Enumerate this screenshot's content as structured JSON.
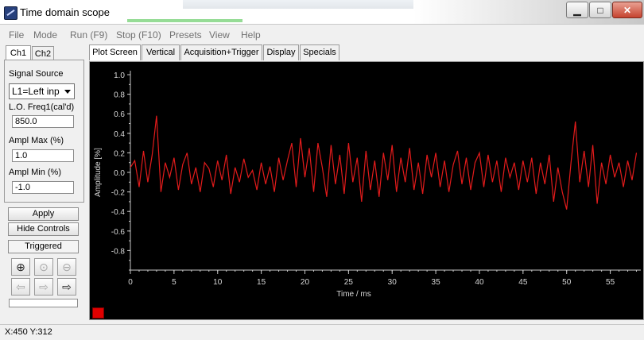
{
  "window": {
    "title": "Time domain scope",
    "minimize_glyph": "▁",
    "maximize_glyph": "□",
    "close_glyph": "✕"
  },
  "menu": [
    "File",
    "Mode",
    "Run (F9)",
    "Stop (F10)",
    "Presets",
    "View",
    "Help"
  ],
  "left_tabs": [
    "Ch1",
    "Ch2"
  ],
  "controls": {
    "signal_source_label": "Signal Source",
    "signal_source_value": "L1=Left inp",
    "lo_freq_label": "L.O. Freq1(cal'd)",
    "lo_freq_value": "850.0",
    "ampl_max_label": "Ampl Max (%)",
    "ampl_max_value": "1.0",
    "ampl_min_label": "Ampl Min (%)",
    "ampl_min_value": "-1.0",
    "apply_label": "Apply",
    "hide_controls_label": "Hide Controls",
    "triggered_label": "Triggered"
  },
  "zoom_icons": [
    "zoom-in-icon",
    "zoom-normal-icon",
    "zoom-out-icon",
    "scroll-left-icon",
    "scroll-right-icon",
    "cursor-icon"
  ],
  "plot_tabs": [
    "Plot Screen",
    "Vertical",
    "Acquisition+Trigger",
    "Display",
    "Specials"
  ],
  "status": "X:450 Y:312",
  "chart_data": {
    "type": "line",
    "xlabel": "Time / ms",
    "ylabel": "Amplitude [%]",
    "xlim": [
      0,
      58.5
    ],
    "ylim": [
      -1.0,
      1.0
    ],
    "x_ticks": [
      0,
      5,
      10,
      15,
      20,
      25,
      30,
      35,
      40,
      45,
      50,
      55
    ],
    "y_ticks": [
      1.0,
      0.8,
      0.6,
      0.4,
      0.2,
      0.0,
      -0.2,
      -0.4,
      -0.6,
      -0.8
    ],
    "y_tick_labels": [
      "1.0",
      "0.8",
      "0.6",
      "0.4",
      "0.2",
      "0.0",
      "-0.2",
      "-0.4",
      "-0.6",
      "-0.8"
    ],
    "grid": false,
    "line_color": "#e21b1b",
    "axis_color": "#c8c8c8",
    "background": "#000000",
    "series": [
      {
        "x": [
          0,
          0.5,
          1,
          1.5,
          2,
          2.5,
          3,
          3.5,
          4,
          4.5,
          5,
          5.5,
          6,
          6.5,
          7,
          7.5,
          8,
          8.5,
          9,
          9.5,
          10,
          10.5,
          11,
          11.5,
          12,
          12.5,
          13,
          13.5,
          14,
          14.5,
          15,
          15.5,
          16,
          16.5,
          17,
          17.5,
          18,
          18.5,
          19,
          19.5,
          20,
          20.5,
          21,
          21.5,
          22,
          22.5,
          23,
          23.5,
          24,
          24.5,
          25,
          25.5,
          26,
          26.5,
          27,
          27.5,
          28,
          28.5,
          29,
          29.5,
          30,
          30.5,
          31,
          31.5,
          32,
          32.5,
          33,
          33.5,
          34,
          34.5,
          35,
          35.5,
          36,
          36.5,
          37,
          37.5,
          38,
          38.5,
          39,
          39.5,
          40,
          40.5,
          41,
          41.5,
          42,
          42.5,
          43,
          43.5,
          44,
          44.5,
          45,
          45.5,
          46,
          46.5,
          47,
          47.5,
          48,
          48.5,
          49,
          49.5,
          50,
          50.5,
          51,
          51.5,
          52,
          52.5,
          53,
          53.5,
          54,
          54.5,
          55,
          55.5,
          56,
          56.5,
          57,
          57.5,
          58
        ],
        "values": [
          0.05,
          0.12,
          -0.15,
          0.22,
          -0.1,
          0.18,
          0.58,
          -0.2,
          0.1,
          -0.05,
          0.15,
          -0.18,
          0.08,
          0.2,
          -0.12,
          0.05,
          -0.2,
          0.1,
          0.04,
          -0.15,
          0.12,
          -0.08,
          0.18,
          -0.22,
          0.05,
          -0.1,
          0.14,
          -0.05,
          0.02,
          -0.18,
          0.1,
          -0.12,
          0.06,
          -0.2,
          0.15,
          -0.08,
          0.12,
          0.3,
          -0.15,
          0.35,
          -0.05,
          0.25,
          -0.2,
          0.3,
          0.05,
          -0.25,
          0.28,
          -0.12,
          0.18,
          -0.22,
          0.3,
          -0.1,
          0.15,
          -0.3,
          0.22,
          -0.18,
          0.12,
          -0.25,
          0.2,
          -0.08,
          0.28,
          -0.2,
          0.15,
          -0.1,
          0.25,
          -0.18,
          0.1,
          -0.22,
          0.18,
          -0.05,
          0.2,
          -0.15,
          0.12,
          -0.2,
          0.08,
          0.22,
          -0.12,
          0.15,
          -0.18,
          0.1,
          0.2,
          -0.15,
          0.18,
          -0.1,
          0.12,
          -0.2,
          0.15,
          -0.05,
          0.1,
          -0.18,
          0.12,
          -0.1,
          0.15,
          -0.22,
          0.1,
          -0.12,
          0.18,
          -0.3,
          0.05,
          -0.2,
          -0.38,
          0.1,
          0.52,
          -0.1,
          0.22,
          -0.15,
          0.28,
          -0.32,
          0.1,
          -0.12,
          0.18,
          -0.05,
          0.1,
          -0.15,
          0.12,
          -0.08,
          0.2
        ]
      }
    ]
  }
}
